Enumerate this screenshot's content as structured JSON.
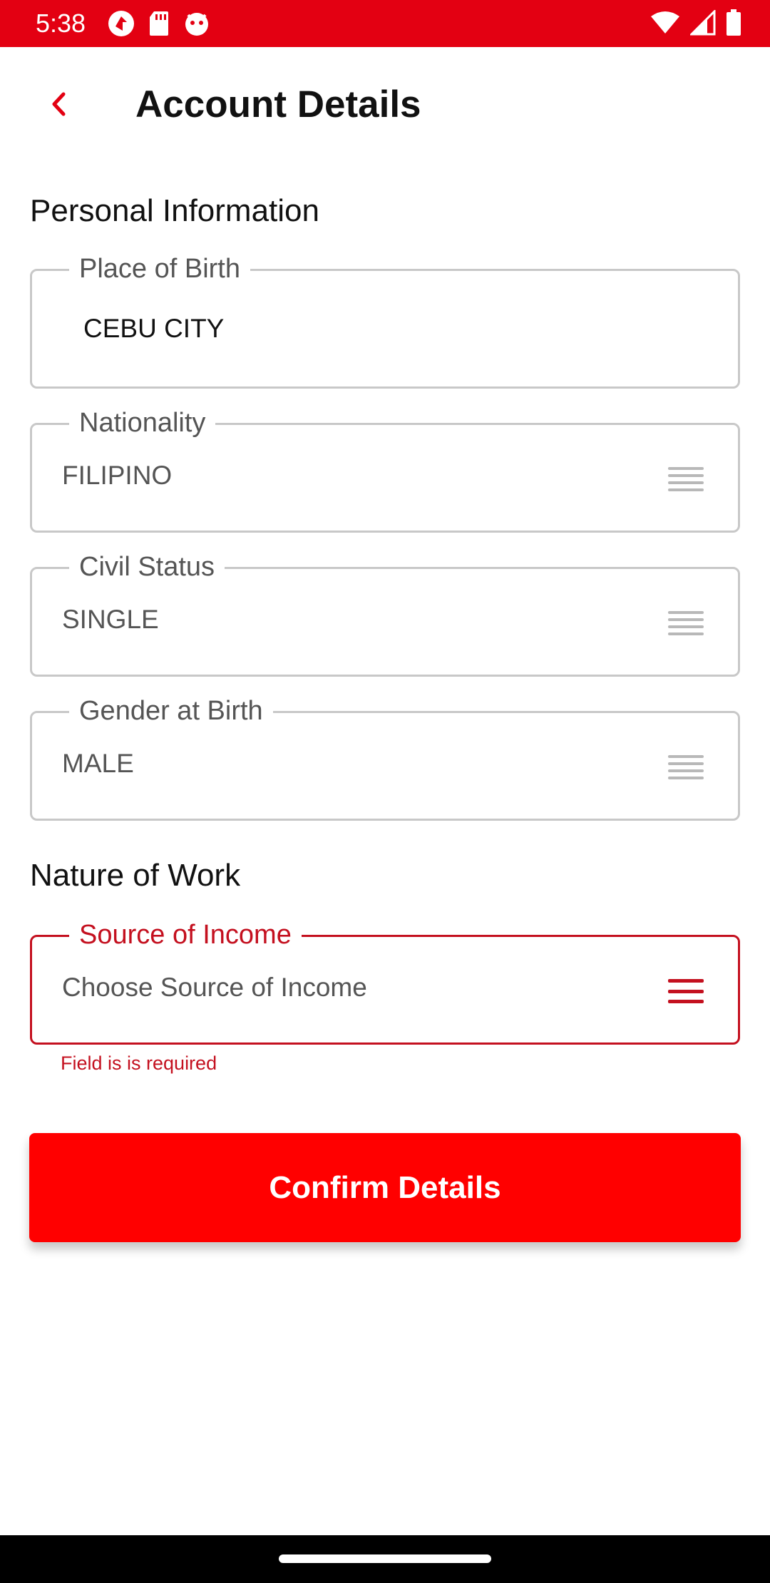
{
  "status_bar": {
    "time": "5:38",
    "left_icons": [
      "app-notification-icon",
      "sd-card-icon",
      "app-face-icon"
    ],
    "right_icons": [
      "wifi-icon",
      "cellular-signal-icon",
      "battery-icon"
    ]
  },
  "header": {
    "title": "Account Details",
    "back_icon": "chevron-left-icon"
  },
  "personal_info": {
    "section_title": "Personal Information",
    "place_of_birth": {
      "label": "Place of Birth",
      "value": "CEBU CITY"
    },
    "nationality": {
      "label": "Nationality",
      "value": "FILIPINO"
    },
    "civil_status": {
      "label": "Civil Status",
      "value": "SINGLE"
    },
    "gender_at_birth": {
      "label": "Gender at Birth",
      "value": "MALE"
    }
  },
  "nature_of_work": {
    "section_title": "Nature of Work",
    "source_of_income": {
      "label": "Source of Income",
      "placeholder": "Choose Source of Income",
      "error": "Field is is required"
    }
  },
  "actions": {
    "confirm_label": "Confirm Details"
  },
  "colors": {
    "brand_red": "#e30012",
    "button_red": "#ff0000",
    "error_red": "#c4101f",
    "border_gray": "#c8c8c8"
  }
}
